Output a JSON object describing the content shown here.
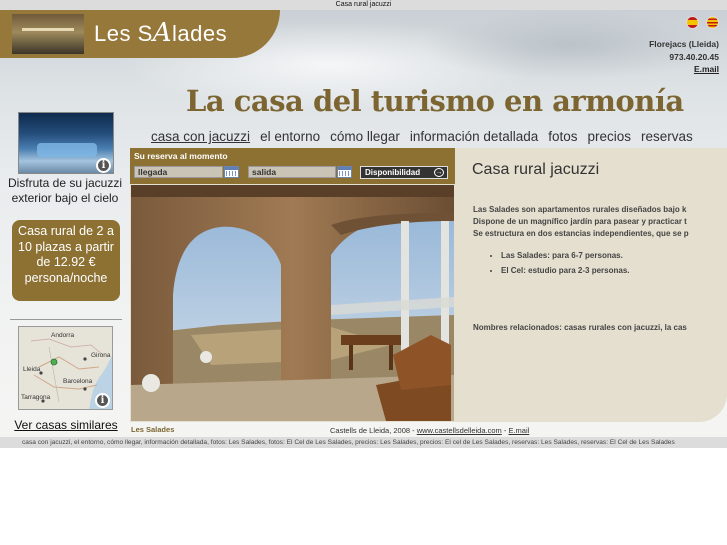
{
  "window": {
    "title": "Casa rural jacuzzi"
  },
  "logo": {
    "text_prefix": "Les S",
    "text_mark": "A",
    "text_suffix": "lades"
  },
  "languages": [
    "es",
    "ca"
  ],
  "contact": {
    "location": "Florejacs (Lleida)",
    "phone": "973.40.20.45",
    "email": "E.mail"
  },
  "headline": "La casa del turismo en armonía",
  "nav": [
    {
      "label": "casa con jacuzzi",
      "active": true
    },
    {
      "label": "el entorno",
      "active": false
    },
    {
      "label": "cómo llegar",
      "active": false
    },
    {
      "label": "información detallada",
      "active": false
    },
    {
      "label": "fotos",
      "active": false
    },
    {
      "label": "precios",
      "active": false
    },
    {
      "label": "reservas",
      "active": false
    }
  ],
  "sidebar": {
    "jacuzzi_caption": "Disfruta de su jacuzzi exterior bajo el cielo",
    "price_text": "Casa rural de 2 a 10 plazas a partir de 12.92 € persona/noche",
    "map_labels": [
      "Andorra",
      "Lleida",
      "Girona",
      "Barcelona",
      "Tarragona"
    ],
    "similar_link": "Ver casas similares"
  },
  "booking": {
    "title": "Su reserva al momento",
    "arrival_value": "llegada",
    "departure_value": "salida",
    "availability_button": "Disponibilidad"
  },
  "photo_caption": "Les Salades",
  "content": {
    "title": "Casa rural jacuzzi",
    "paragraph_lines": [
      "Las Salades son apartamentos rurales diseñados bajo k",
      "Dispone de un magnífico jardín para pasear y practicar t",
      "Se estructura en dos estancias independientes, que se p"
    ],
    "list": [
      "Las Salades: para 6-7 personas.",
      "El Cel: estudio para 2-3 personas."
    ],
    "related": "Nombres relacionados: casas rurales con jacuzzi, la cas"
  },
  "footer": {
    "copyright": "Castells de Lleida, 2008 - ",
    "site_link": "www.castellsdelleida.com",
    "separator": " - ",
    "email_link": "E.mail",
    "links_line": "casa con jacuzzi, el entorno, cómo llegar, información detallada, fotos: Les Salades, fotos: El Cel de Les Salades, precios: Les Salades, precios: El cel de Les Salades, reservas: Les Salades, reservas: El Cel de Les Salades"
  },
  "colors": {
    "brand_brown": "#8d7133",
    "headline_brown": "#7c6530",
    "content_bg": "#e4dfcf"
  }
}
